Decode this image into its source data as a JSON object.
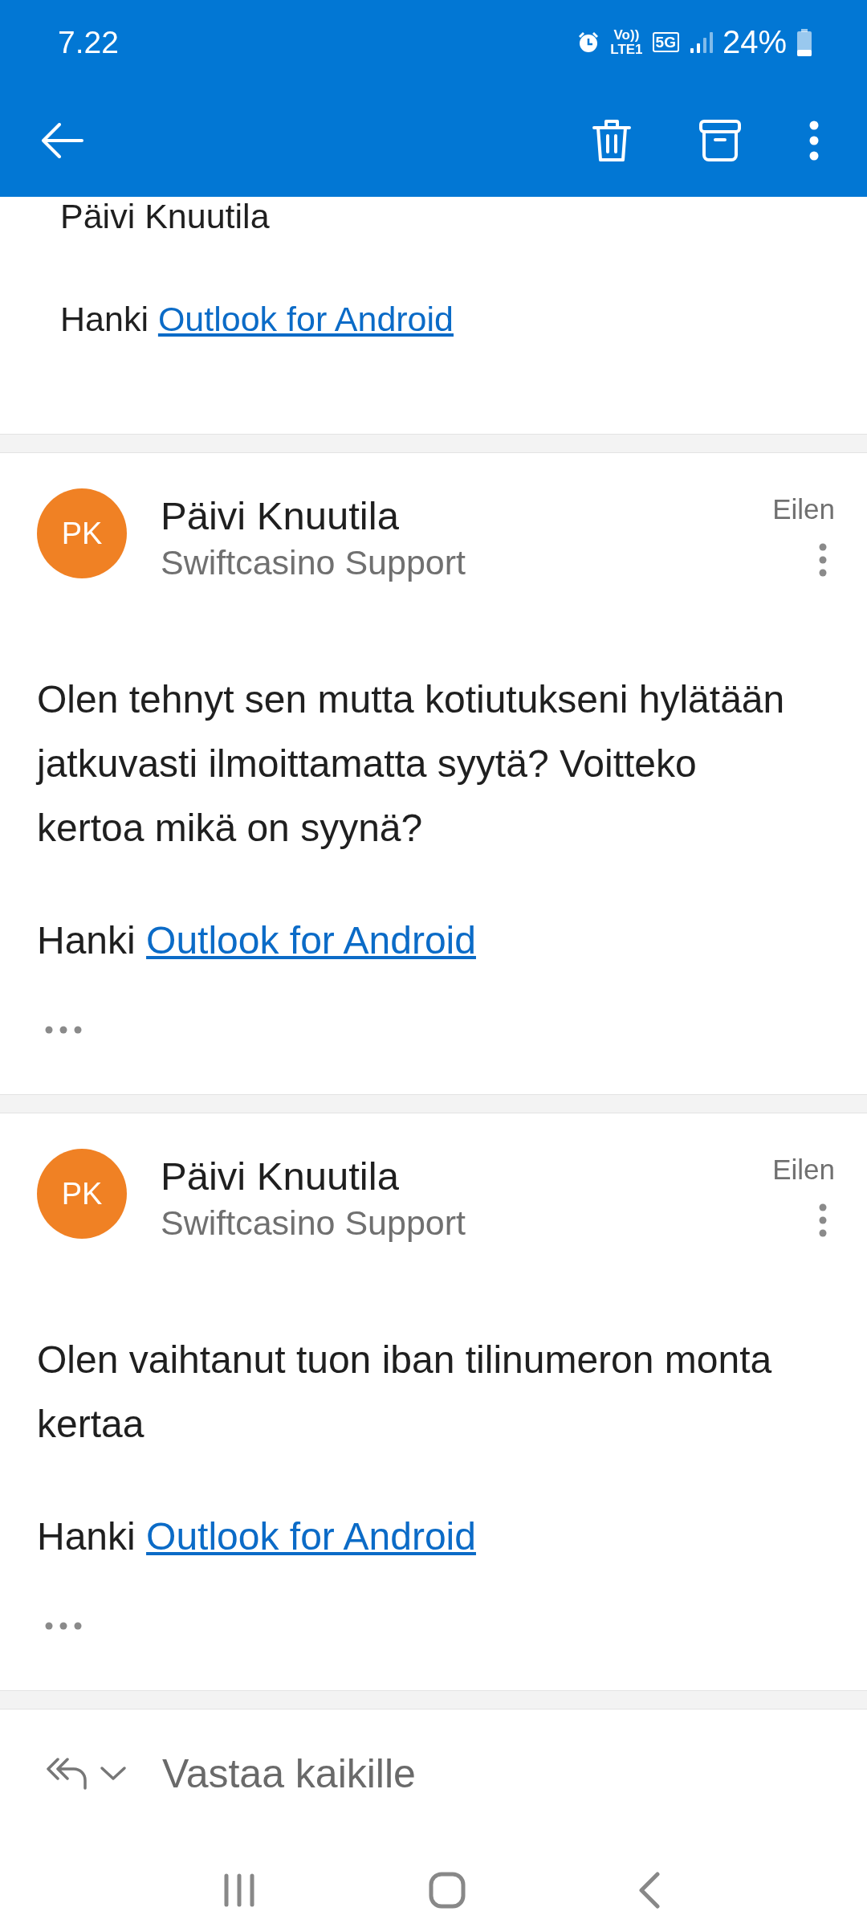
{
  "status_bar": {
    "time": "7.22",
    "volte": "Vo))",
    "network": "LTE1",
    "generation": "5G",
    "battery": "24%"
  },
  "toolbar": {
    "actions": [
      {
        "kind": "delete"
      },
      {
        "kind": "archive"
      },
      {
        "kind": "more"
      }
    ]
  },
  "previous_message": {
    "signature": "Päivi Knuutila",
    "footer_prefix": "Hanki",
    "footer_link": "Outlook for Android"
  },
  "messages": [
    {
      "initials": "PK",
      "sender": "Päivi Knuutila",
      "recipient": "Swiftcasino Support",
      "date": "Eilen",
      "body": "Olen tehnyt sen mutta kotiutukseni hylätään jatkuvasti ilmoittamatta syytä? Voitteko kertoa mikä on syynä?",
      "footer_prefix": "Hanki",
      "footer_link": "Outlook for Android"
    },
    {
      "initials": "PK",
      "sender": "Päivi Knuutila",
      "recipient": "Swiftcasino Support",
      "date": "Eilen",
      "body": "Olen vaihtanut tuon iban tilinumeron monta kertaa",
      "footer_prefix": "Hanki",
      "footer_link": "Outlook for Android"
    }
  ],
  "reply_bar": {
    "label": "Vastaa kaikille"
  }
}
